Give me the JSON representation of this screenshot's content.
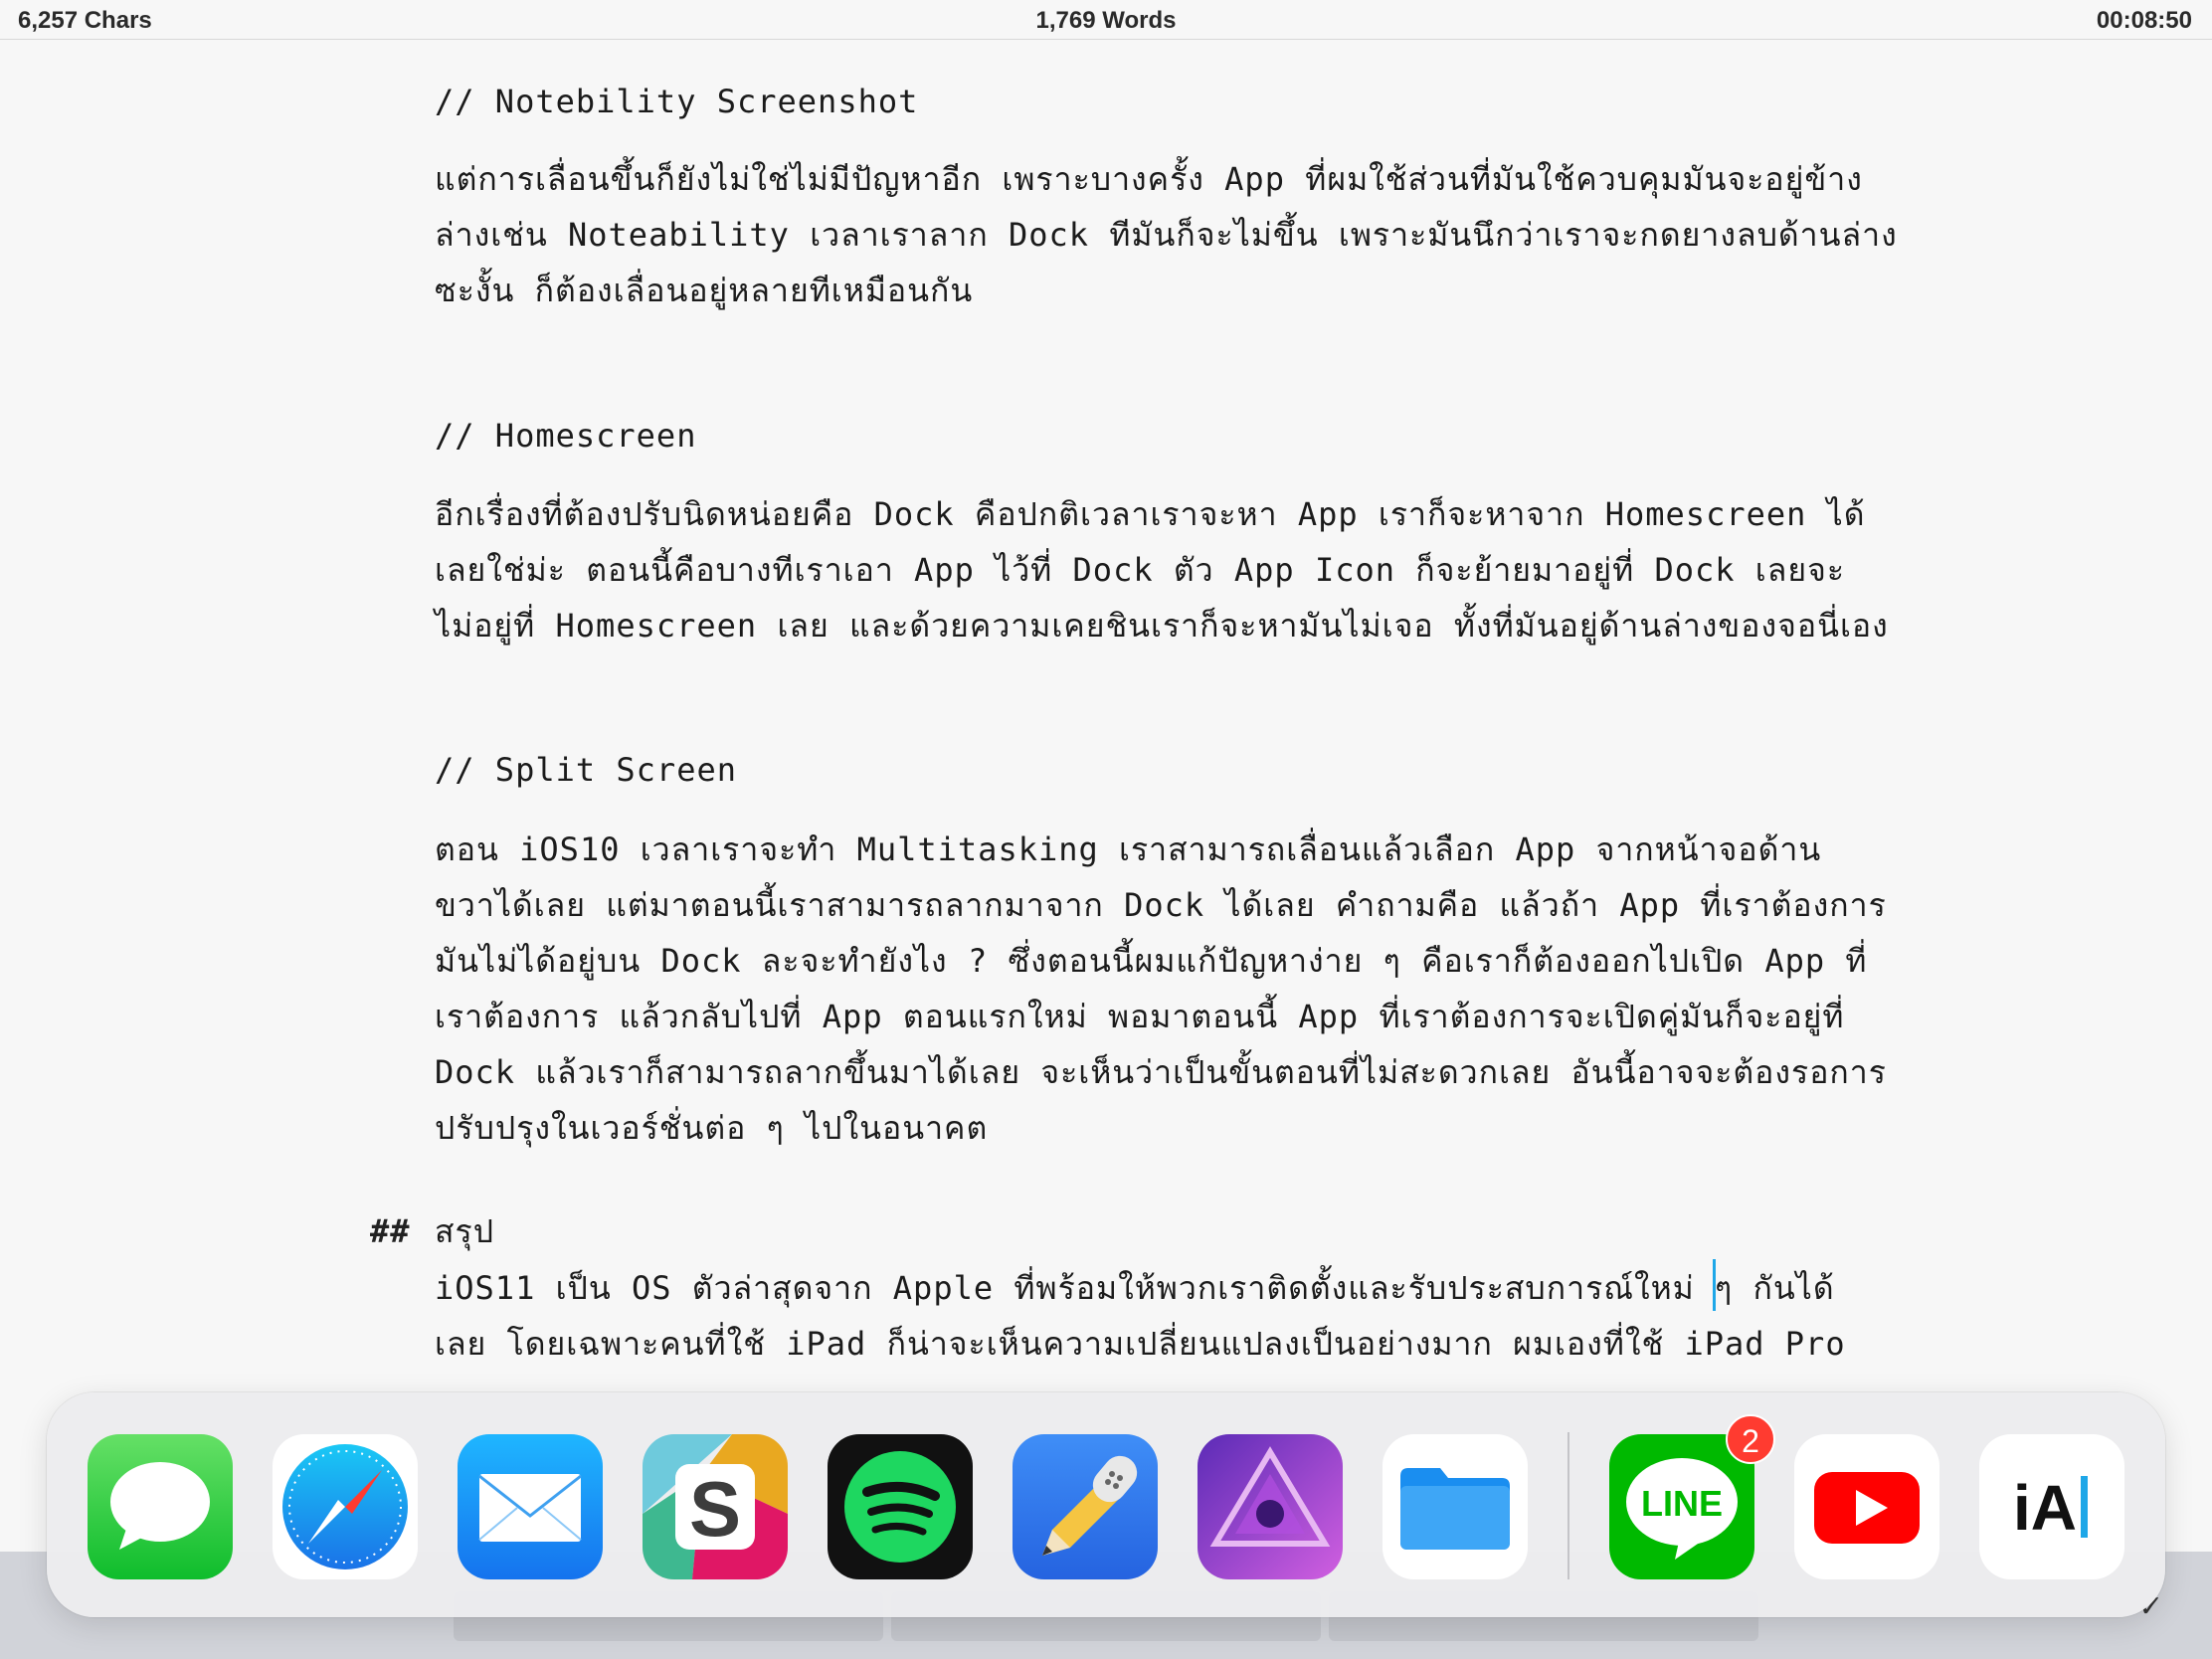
{
  "status": {
    "chars": "6,257 Chars",
    "words": "1,769 Words",
    "timer": "00:08:50"
  },
  "editor": {
    "lines": [
      "// Notebility Screenshot",
      "แต่การเลื่อนขึ้นก็ยังไม่ใช่ไม่มีปัญหาอีก เพราะบางครั้ง App ที่ผมใช้ส่วนที่มันใช้ควบคุมมันจะอยู่ข้าง",
      "ล่างเช่น Noteability เวลาเราลาก Dock ทีมันก็จะไม่ขึ้น เพราะมันนึกว่าเราจะกดยางลบด้านล่าง",
      "ซะงั้น ก็ต้องเลื่อนอยู่หลายทีเหมือนกัน",
      "// Homescreen",
      "อีกเรื่องที่ต้องปรับนิดหน่อยคือ Dock คือปกติเวลาเราจะหา App เราก็จะหาจาก Homescreen ได้",
      "เลยใช่ม่ะ ตอนนี้คือบางทีเราเอา App ไว้ที่ Dock ตัว App Icon ก็จะย้ายมาอยู่ที่ Dock เลยจะ",
      "ไม่อยู่ที่ Homescreen เลย และด้วยความเคยชินเราก็จะหามันไม่เจอ ทั้งที่มันอยู่ด้านล่างของจอนี่เอง",
      "// Split Screen",
      "ตอน iOS10 เวลาเราจะทำ Multitasking เราสามารถเลื่อนแล้วเลือก App จากหน้าจอด้าน",
      "ขวาได้เลย แต่มาตอนนี้เราสามารถลากมาจาก Dock ได้เลย คำถามคือ แล้วถ้า App ที่เราต้องการ",
      "มันไม่ได้อยู่บน Dock ละจะทำยังไง ? ซึ่งตอนนี้ผมแก้ปัญหาง่าย ๆ คือเราก็ต้องออกไปเปิด App ที่",
      "เราต้องการ แล้วกลับไปที่ App ตอนแรกใหม่ พอมาตอนนี้ App ที่เราต้องการจะเปิดคู่มันก็จะอยู่ที่",
      "Dock แล้วเราก็สามารถลากขึ้นมาได้เลย จะเห็นว่าเป็นขั้นตอนที่ไม่สะดวกเลย อันนี้อาจจะต้องรอการ",
      "ปรับปรุงในเวอร์ชั่นต่อ ๆ ไปในอนาคต",
      "สรุป",
      "iOS11 เป็น OS ตัวล่าสุดจาก Apple ที่พร้อมให้พวกเราติดตั้งและรับประสบการณ์ใหม่ ๆ กันได้",
      "เลย โดยเฉพาะคนที่ใช้ iPad ก็น่าจะเห็นความเปลี่ยนแปลงเป็นอย่างมาก ผมเองที่ใช้ iPad Pro"
    ],
    "heading_mark": "##"
  },
  "dock": {
    "apps": [
      {
        "name": "Messages",
        "icon": "messages-icon"
      },
      {
        "name": "Safari",
        "icon": "safari-icon"
      },
      {
        "name": "Mail",
        "icon": "mail-icon"
      },
      {
        "name": "Slack",
        "icon": "slack-icon"
      },
      {
        "name": "Spotify",
        "icon": "spotify-icon"
      },
      {
        "name": "Notability",
        "icon": "notability-icon"
      },
      {
        "name": "Affinity Photo",
        "icon": "affinity-photo-icon"
      },
      {
        "name": "Files",
        "icon": "files-icon"
      },
      {
        "name": "LINE",
        "icon": "line-icon",
        "label": "LINE",
        "badge": "2"
      },
      {
        "name": "YouTube",
        "icon": "youtube-icon"
      },
      {
        "name": "iA Writer",
        "icon": "ia-writer-icon",
        "label": "iA"
      }
    ]
  },
  "toolbar": {
    "done_label": "✓"
  },
  "colors": {
    "cursor": "#1ea7e8",
    "badge": "#ff3b30",
    "background": "#f7f7f7"
  }
}
